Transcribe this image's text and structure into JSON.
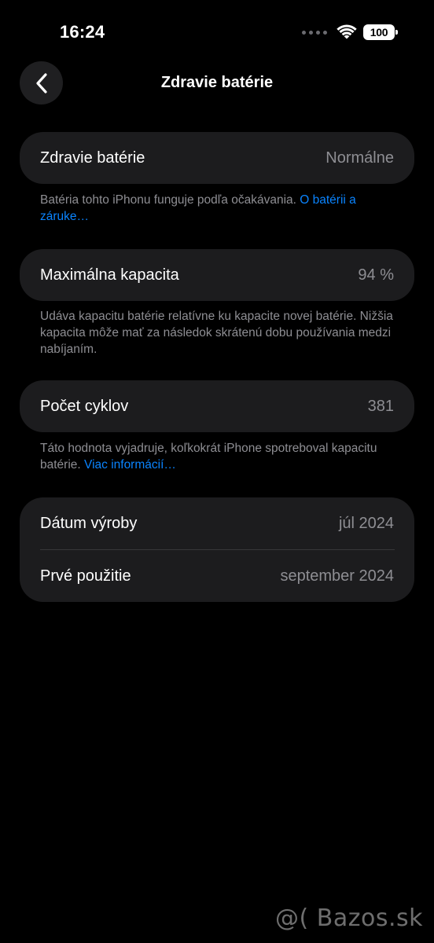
{
  "status_bar": {
    "time": "16:24",
    "battery_level": "100",
    "icons": [
      "signal-dots-icon",
      "wifi-icon",
      "battery-icon"
    ]
  },
  "nav": {
    "title": "Zdravie batérie",
    "back_icon": "chevron-left-icon"
  },
  "battery_health": {
    "label": "Zdravie batérie",
    "value": "Normálne",
    "note_text": "Batéria tohto iPhonu funguje podľa očakávania. ",
    "note_link": "O batérii a záruke…"
  },
  "max_capacity": {
    "label": "Maximálna kapacita",
    "value": "94 %",
    "note_text": "Udáva kapacitu batérie relatívne ku kapacite novej batérie. Nižšia kapacita môže mať za následok skrátenú dobu používania medzi nabíjaním."
  },
  "cycle_count": {
    "label": "Počet cyklov",
    "value": "381",
    "note_text": "Táto hodnota vyjadruje, koľkokrát iPhone spotreboval kapacitu batérie. ",
    "note_link": "Viac informácií…"
  },
  "dates": {
    "manufacture_label": "Dátum výroby",
    "manufacture_value": "júl 2024",
    "first_use_label": "Prvé použitie",
    "first_use_value": "september 2024"
  },
  "watermark": "@( Bazos.sk",
  "colors": {
    "background": "#000000",
    "card": "#1c1c1e",
    "secondary_text": "#8e8e93",
    "link": "#0a84ff"
  }
}
